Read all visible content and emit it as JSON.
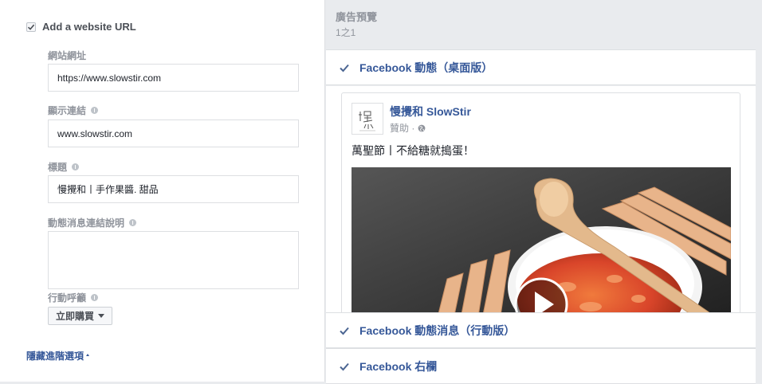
{
  "form": {
    "add_url_label": "Add a website URL",
    "website_url": {
      "label": "網站網址",
      "value": "https://www.slowstir.com"
    },
    "display_link": {
      "label": "顯示連結",
      "value": "www.slowstir.com"
    },
    "headline": {
      "label": "標題",
      "value": "慢攪和丨手作果醬. 甜品"
    },
    "news_feed_description": {
      "label": "動態消息連結說明",
      "value": ""
    },
    "cta": {
      "label": "行動呼籲",
      "value": "立即購買"
    },
    "hide_advanced": "隱藏進階選項"
  },
  "preview": {
    "title": "廣告預覽",
    "count": "1之1",
    "placements": [
      {
        "label": "Facebook 動態（桌面版）"
      },
      {
        "label": "Facebook 動態消息（行動版）"
      },
      {
        "label": "Facebook 右欄"
      }
    ],
    "post": {
      "page_name": "慢攪和 SlowStir",
      "sponsored": "贊助 ·",
      "text": "萬聖節丨不給糖就搗蛋！"
    }
  },
  "colors": {
    "link_blue": "#365899",
    "muted_gray": "#90949c",
    "jam_orange": "#d9452a",
    "wood": "#e8b48a"
  }
}
